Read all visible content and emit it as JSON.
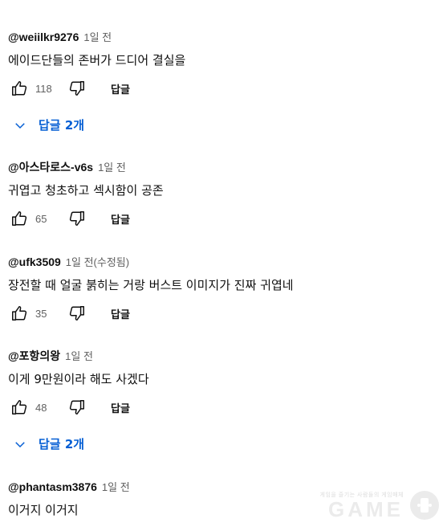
{
  "comments": [
    {
      "author": "@weiilkr9276",
      "time": "1일 전",
      "text": "에이드단들의 존버가 드디어 결실을",
      "likes": "118",
      "reply_label": "답글",
      "replies_label": "답글 2개"
    },
    {
      "author": "@아스타로스-v6s",
      "time": "1일 전",
      "text": "귀엽고 청초하고 섹시함이 공존",
      "likes": "65",
      "reply_label": "답글"
    },
    {
      "author": "@ufk3509",
      "time": "1일 전(수정됨)",
      "text": "장전할 때 얼굴 붉히는 거랑 버스트 이미지가 진짜 귀엽네",
      "likes": "35",
      "reply_label": "답글"
    },
    {
      "author": "@포항의왕",
      "time": "1일 전",
      "text": "이게 9만원이라 해도 사겠다",
      "likes": "48",
      "reply_label": "답글",
      "replies_label": "답글 2개"
    },
    {
      "author": "@phantasm3876",
      "time": "1일 전",
      "text": "이거지 이거지"
    }
  ],
  "watermark": {
    "small": "게임을 즐기는 사람들의 게임매체",
    "big": "GAME"
  },
  "colors": {
    "link_blue": "#065fd4",
    "secondary_text": "#606060",
    "primary_text": "#0f0f0f"
  },
  "icons": [
    "thumb-up-icon",
    "thumb-down-icon",
    "chevron-down-icon"
  ]
}
